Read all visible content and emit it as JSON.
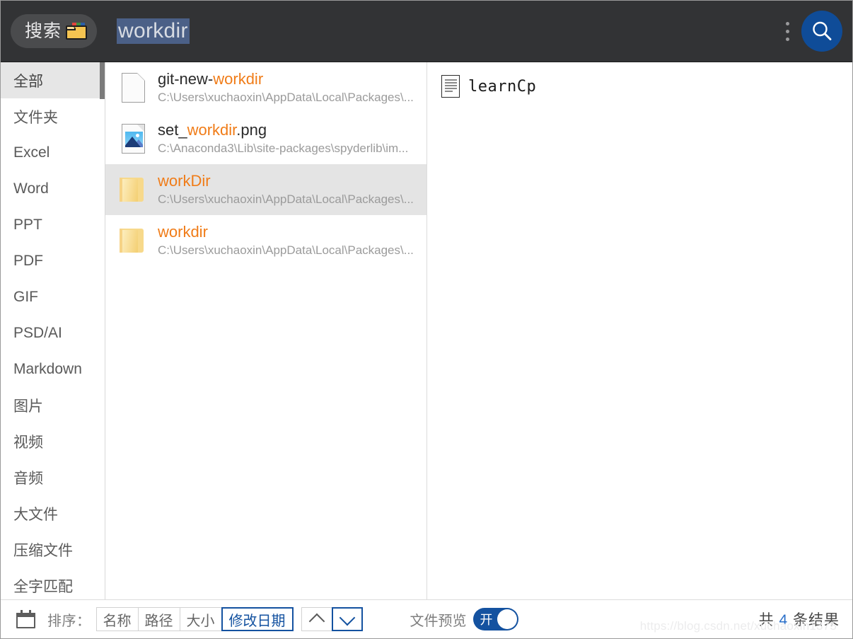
{
  "header": {
    "search_pill_label": "搜索",
    "folder_icon": "folder-color-icon",
    "query_value": "workdir",
    "query_placeholder": "搜索",
    "menu_icon": "kebab-menu-icon",
    "search_icon": "search-icon",
    "accent_color": "#0f4c98"
  },
  "sidebar": {
    "items": [
      {
        "label": "全部",
        "active": true
      },
      {
        "label": "文件夹",
        "active": false
      },
      {
        "label": "Excel",
        "active": false
      },
      {
        "label": "Word",
        "active": false
      },
      {
        "label": "PPT",
        "active": false
      },
      {
        "label": "PDF",
        "active": false
      },
      {
        "label": "GIF",
        "active": false
      },
      {
        "label": "PSD/AI",
        "active": false
      },
      {
        "label": "Markdown",
        "active": false
      },
      {
        "label": "图片",
        "active": false
      },
      {
        "label": "视频",
        "active": false
      },
      {
        "label": "音频",
        "active": false
      },
      {
        "label": "大文件",
        "active": false
      },
      {
        "label": "压缩文件",
        "active": false
      },
      {
        "label": "全字匹配",
        "active": false
      }
    ]
  },
  "results": {
    "highlight_color": "#f07c18",
    "items": [
      {
        "icon": "document-icon",
        "name_pre": "git-new-",
        "name_match": "workdir",
        "name_post": "",
        "path": "C:\\Users\\xuchaoxin\\AppData\\Local\\Packages\\...",
        "selected": false
      },
      {
        "icon": "image-file-icon",
        "name_pre": "set_",
        "name_match": "workdir",
        "name_post": ".png",
        "path": "C:\\Anaconda3\\Lib\\site-packages\\spyderlib\\im...",
        "selected": false
      },
      {
        "icon": "folder-icon",
        "name_pre": "",
        "name_match": "workDir",
        "name_post": "",
        "path": "C:\\Users\\xuchaoxin\\AppData\\Local\\Packages\\...",
        "selected": true
      },
      {
        "icon": "folder-icon",
        "name_pre": "",
        "name_match": "workdir",
        "name_post": "",
        "path": "C:\\Users\\xuchaoxin\\AppData\\Local\\Packages\\...",
        "selected": false
      }
    ]
  },
  "preview": {
    "icon": "text-document-icon",
    "filename": "learnCp"
  },
  "footer": {
    "calendar_icon": "calendar-icon",
    "sort_label": "排序：",
    "sort_options": [
      {
        "label": "名称",
        "active": false
      },
      {
        "label": "路径",
        "active": false
      },
      {
        "label": "大小",
        "active": false
      },
      {
        "label": "修改日期",
        "active": true
      }
    ],
    "sort_asc_icon": "chevron-up-icon",
    "sort_desc_icon": "chevron-down-icon",
    "sort_direction_active": "desc",
    "file_preview_label": "文件预览",
    "file_preview_state": "开",
    "count_prefix": "共",
    "count_number": "4",
    "count_suffix": "条结果",
    "watermark": "https://blog.csdn.net/xuchaoxin1375"
  }
}
